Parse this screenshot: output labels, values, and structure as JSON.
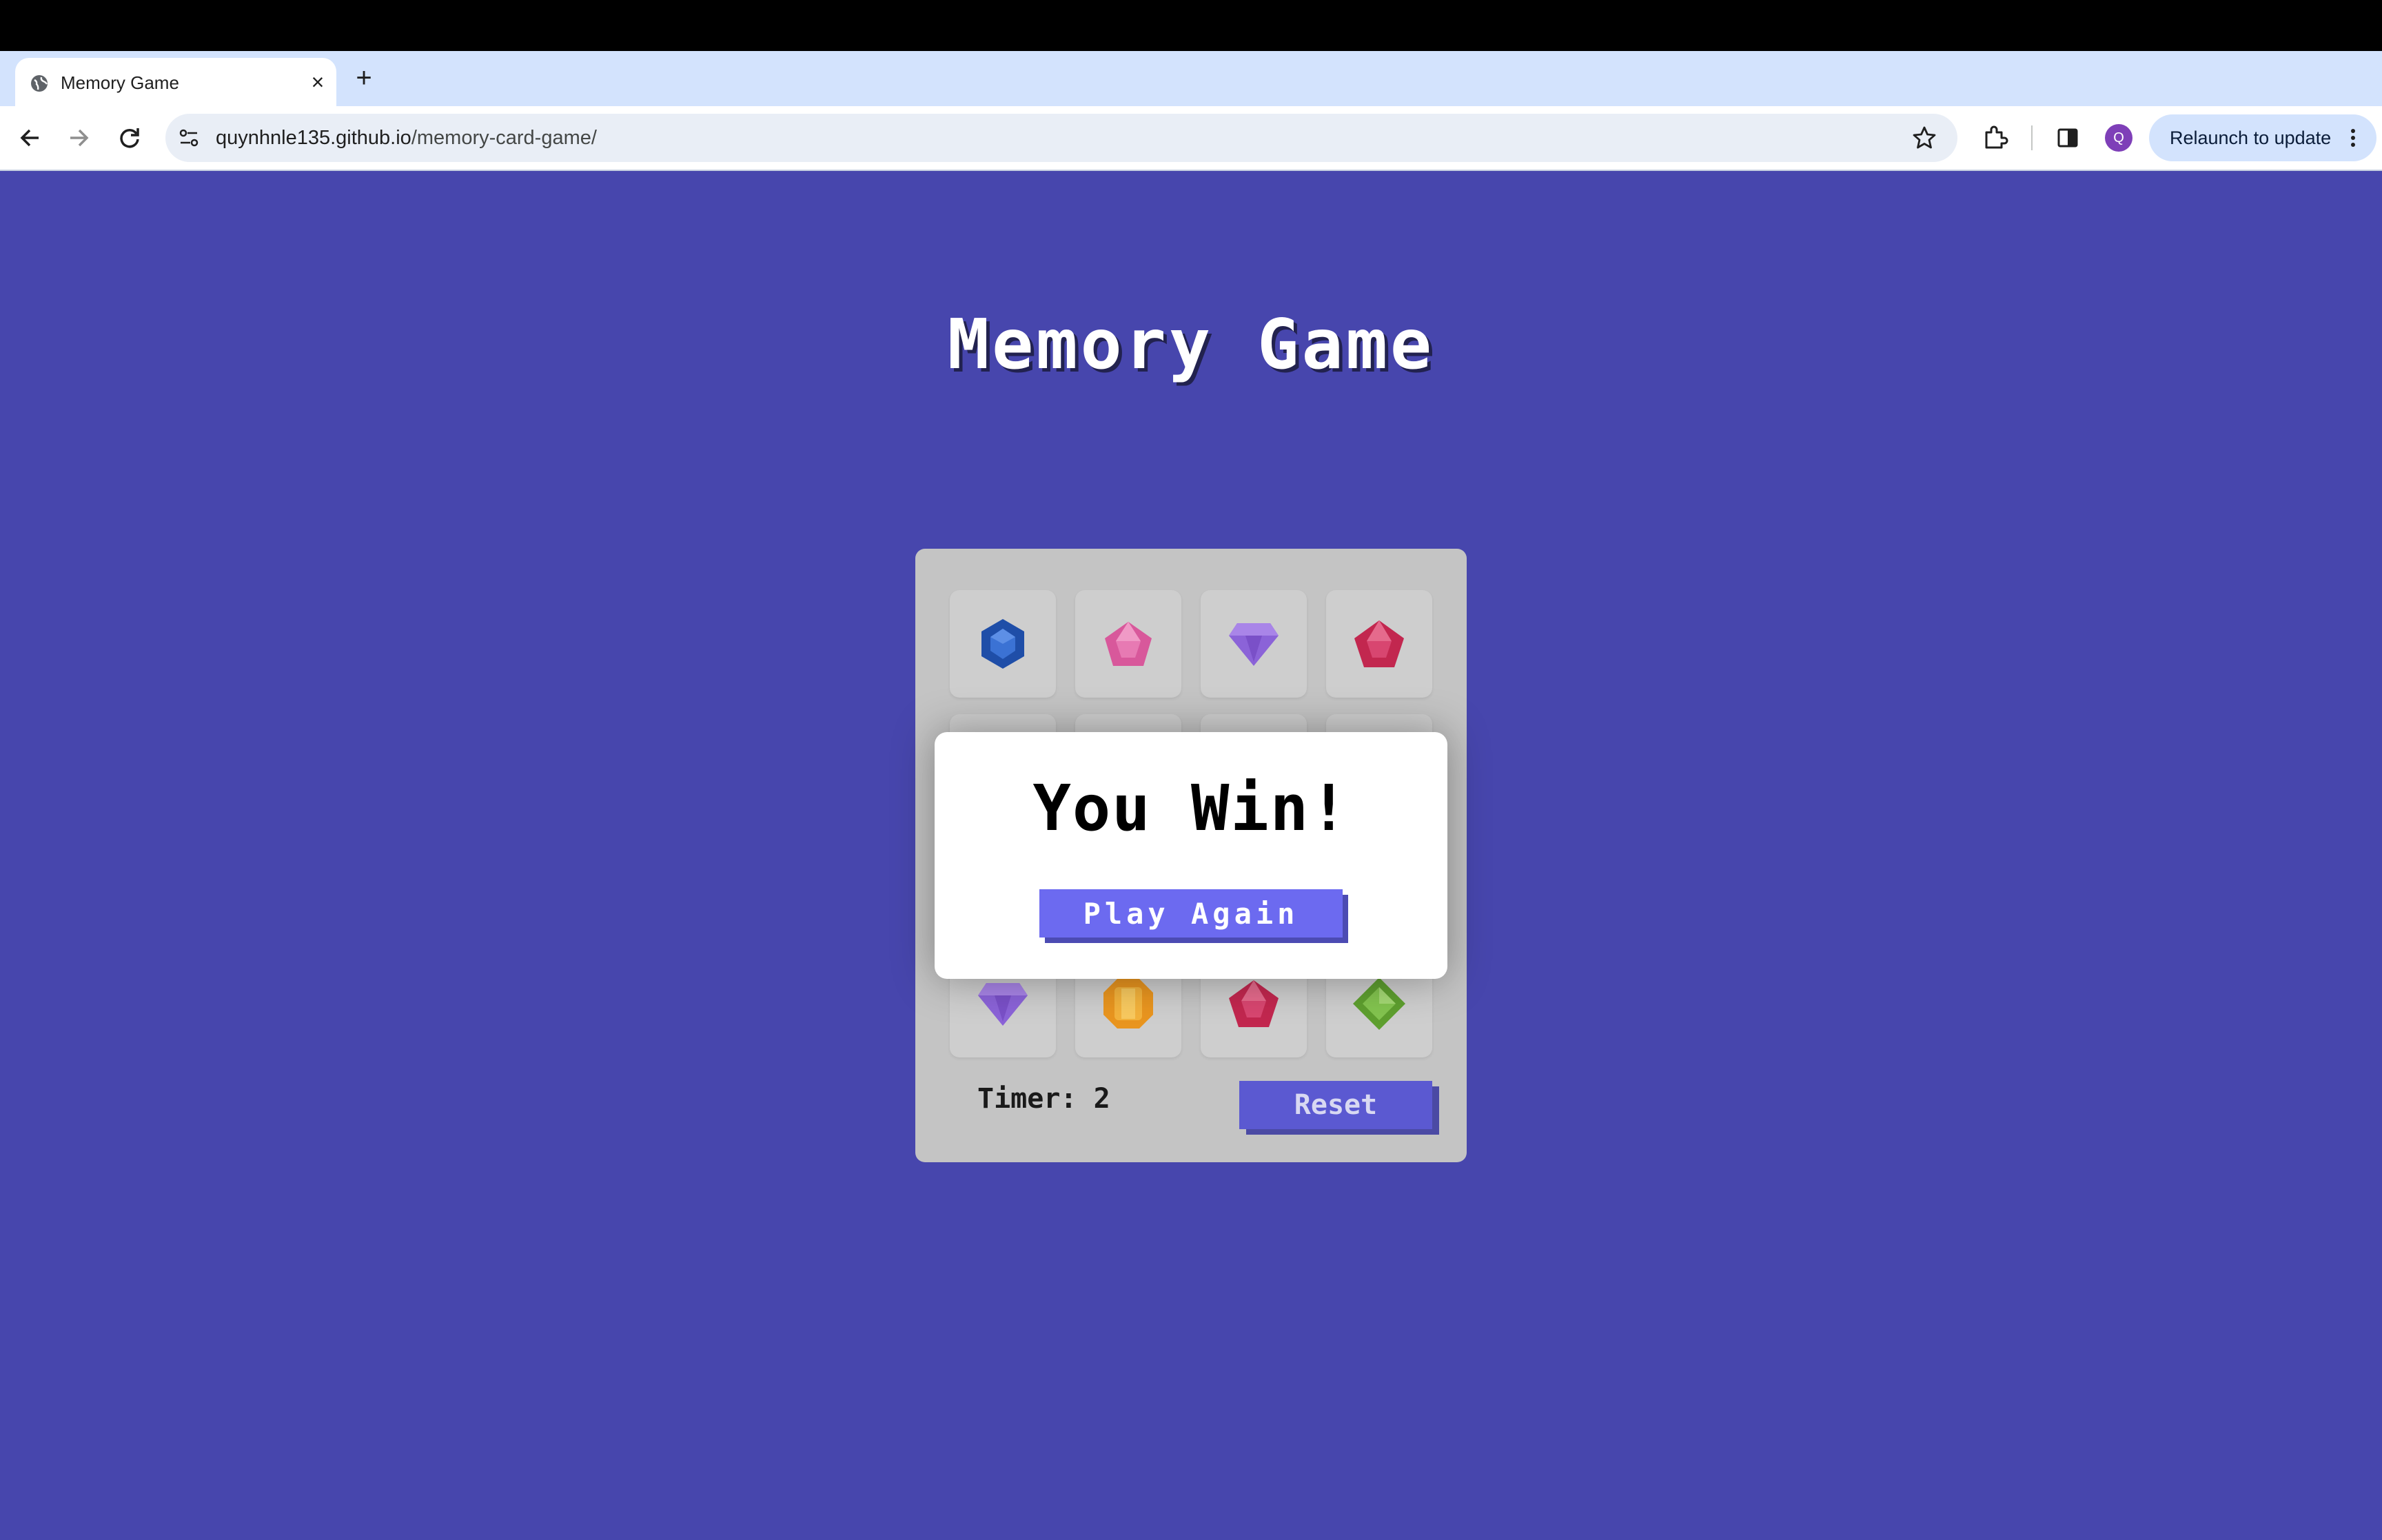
{
  "browser": {
    "tab_title": "Memory Game",
    "url_host": "quynhnle135.github.io",
    "url_path": "/memory-card-game/",
    "avatar_letter": "Q",
    "relaunch_label": "Relaunch to update"
  },
  "game": {
    "title": "Memory Game",
    "timer_label": "Timer: 2",
    "reset_label": "Reset",
    "cards": [
      {
        "gem": "blue-hexagon-gem-icon",
        "color": "#1f4ea8"
      },
      {
        "gem": "pink-pentagon-gem-icon",
        "color": "#d8589b"
      },
      {
        "gem": "purple-diamond-gem-icon",
        "color": "#8b63d8"
      },
      {
        "gem": "red-pentagon-gem-icon",
        "color": "#c2274f"
      },
      {
        "gem": "purple-diamond-gem-icon",
        "color": "#8b63d8"
      },
      {
        "gem": "orange-octagon-gem-icon",
        "color": "#e9951f"
      },
      {
        "gem": "red-pentagon-gem-icon",
        "color": "#c2274f"
      },
      {
        "gem": "green-rhombus-gem-icon",
        "color": "#6fb23c"
      }
    ]
  },
  "modal": {
    "title": "You Win!",
    "button_label": "Play Again"
  },
  "colors": {
    "page_background": "#4746ad",
    "button": "#6c6af0",
    "board": "#c4c4c4"
  }
}
